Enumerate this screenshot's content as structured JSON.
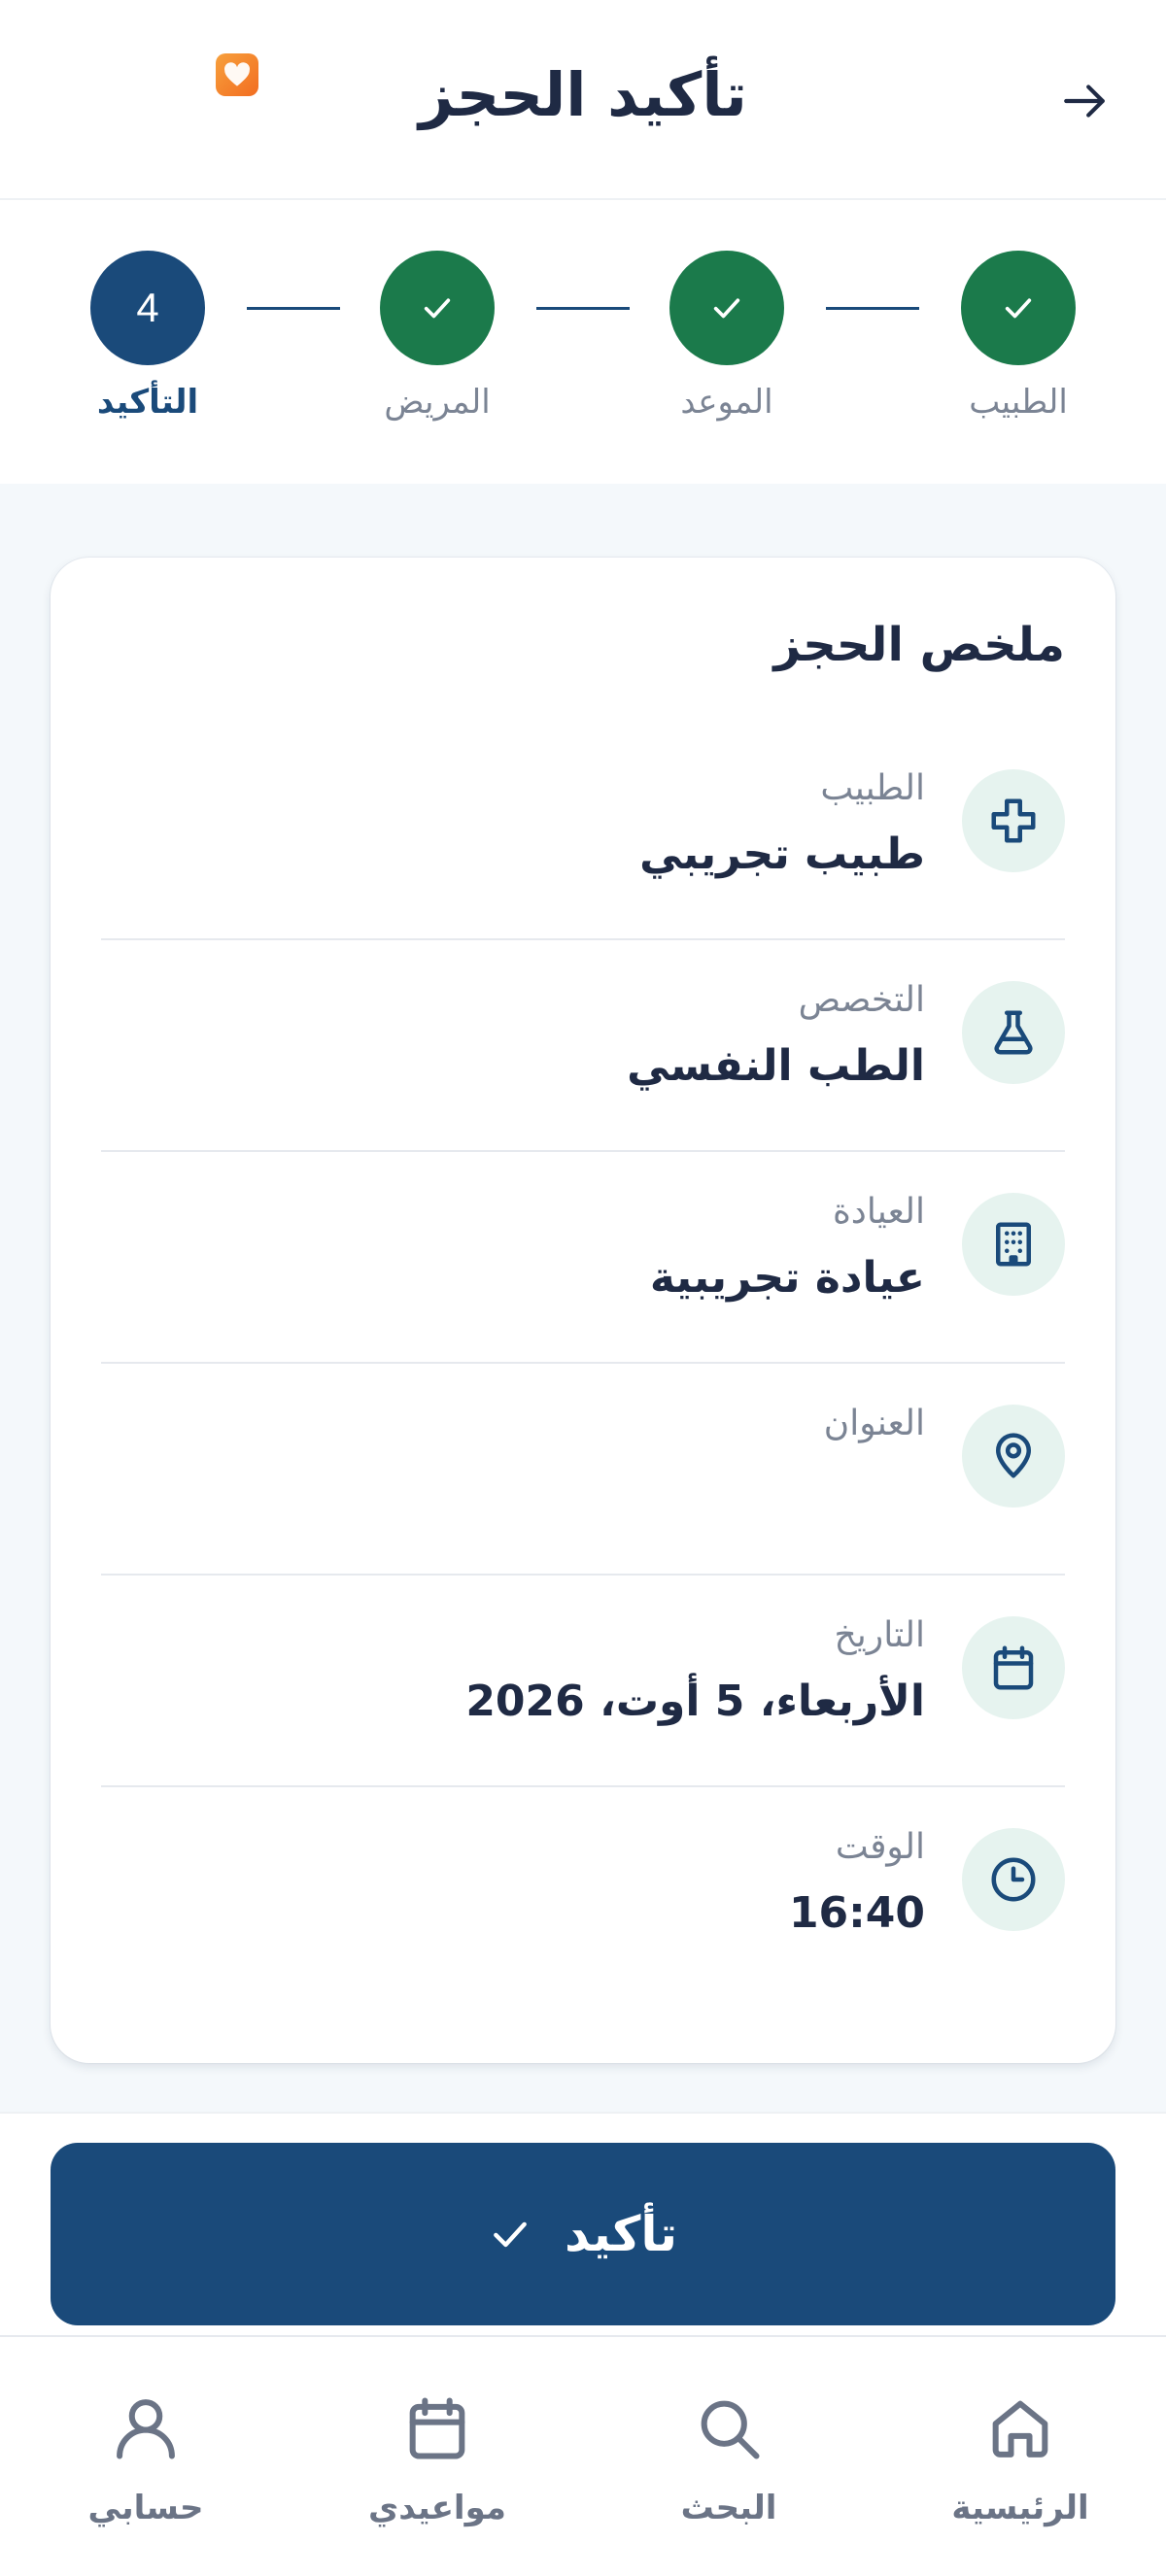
{
  "header": {
    "title": "تأكيد الحجز"
  },
  "stepper": {
    "steps": [
      {
        "label": "الطبيب",
        "state": "done"
      },
      {
        "label": "الموعد",
        "state": "done"
      },
      {
        "label": "المريض",
        "state": "done"
      },
      {
        "label": "التأكيد",
        "state": "active",
        "number": "4"
      }
    ]
  },
  "summary": {
    "title": "ملخص الحجز",
    "rows": [
      {
        "label": "الطبيب",
        "value": "طبيب تجريبي",
        "icon": "medical-cross-icon"
      },
      {
        "label": "التخصص",
        "value": "الطب النفسي",
        "icon": "flask-icon"
      },
      {
        "label": "العيادة",
        "value": "عيادة تجريبية",
        "icon": "building-icon"
      },
      {
        "label": "العنوان",
        "value": "",
        "icon": "location-pin-icon"
      },
      {
        "label": "التاريخ",
        "value": "الأربعاء، 5 أوت، 2026",
        "icon": "calendar-icon"
      },
      {
        "label": "الوقت",
        "value": "16:40",
        "icon": "clock-icon"
      }
    ]
  },
  "confirm": {
    "label": "تأكيد"
  },
  "nav": {
    "items": [
      {
        "label": "الرئيسية",
        "icon": "home-icon"
      },
      {
        "label": "البحث",
        "icon": "search-icon"
      },
      {
        "label": "مواعيدي",
        "icon": "calendar-icon"
      },
      {
        "label": "حسابي",
        "icon": "user-icon"
      }
    ]
  },
  "colors": {
    "primary": "#1a4a7a",
    "success": "#1b7a4b",
    "icon_bg": "#e6f3ef",
    "muted": "#7b8494",
    "badge": "#f26d21"
  }
}
